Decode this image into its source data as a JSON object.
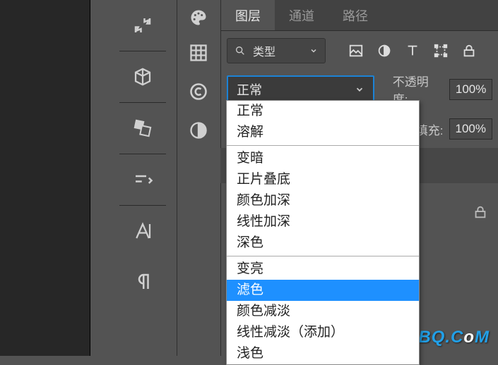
{
  "tabs": {
    "layers": "图层",
    "channels": "通道",
    "paths": "路径"
  },
  "filter": {
    "label": "类型"
  },
  "blend_selector": {
    "value": "正常"
  },
  "opacity": {
    "label": "不透明度:",
    "value": "100%"
  },
  "fill": {
    "label": "填充:",
    "value": "100%"
  },
  "blend_modes": {
    "group1": [
      "正常",
      "溶解"
    ],
    "group2": [
      "变暗",
      "正片叠底",
      "颜色加深",
      "线性加深",
      "深色"
    ],
    "group3": [
      "变亮",
      "滤色",
      "颜色减淡",
      "线性减淡（添加）",
      "浅色"
    ]
  },
  "selected_mode": "滤色",
  "watermark": {
    "pre": "UiBQ.C",
    "o": "o",
    "post": "M"
  },
  "icons": {
    "history": "history-icon",
    "palette": "palette-icon",
    "cube": "cube-icon",
    "blocks": "blocks-icon",
    "fill-shapes": "fill-shapes-icon",
    "brush": "brush-icon",
    "text": "text-a-icon",
    "paragraph": "paragraph-icon",
    "grid": "grid-icon",
    "cc": "cc-icon",
    "contrast": "contrast-icon",
    "image": "image-icon",
    "circle": "circle-half-icon",
    "type": "type-t-icon",
    "transform": "transform-icon",
    "lock": "lock-icon",
    "search": "search-icon",
    "chevron": "chevron-down-icon"
  },
  "chart_data": null
}
